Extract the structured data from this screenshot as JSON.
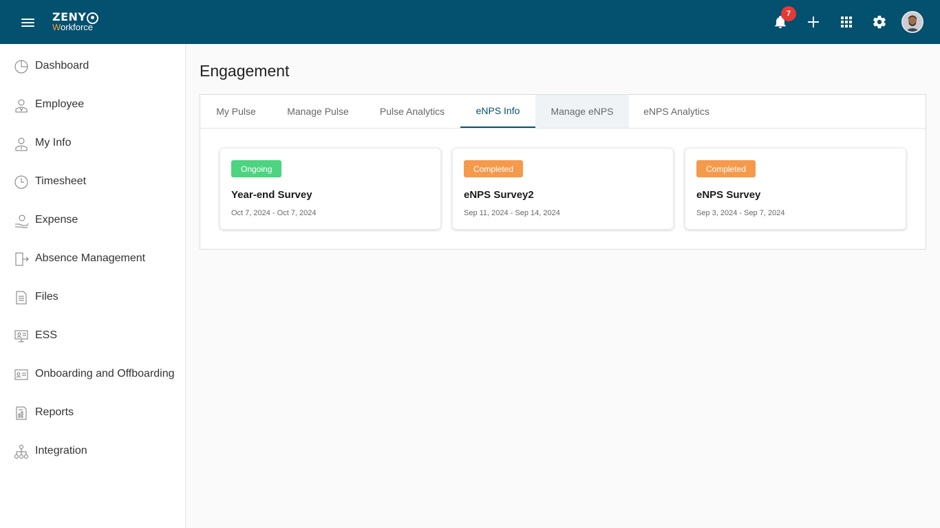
{
  "app": {
    "logo_top": "ZENY",
    "logo_bottom_first": "W",
    "logo_bottom_rest": "orkforce",
    "notification_count": "7",
    "colors": {
      "header": "#03506f",
      "accent": "#f39c45",
      "ongoing": "#4cd480",
      "completed": "#f59a4b",
      "badge": "#e53935"
    }
  },
  "header": {
    "icons": [
      "menu-icon",
      "bell-icon",
      "plus-icon",
      "apps-grid-icon",
      "gear-icon",
      "user-avatar"
    ]
  },
  "sidebar": {
    "items": [
      {
        "label": "Dashboard",
        "icon": "pie-chart-icon"
      },
      {
        "label": "Employee",
        "icon": "employee-icon"
      },
      {
        "label": "My Info",
        "icon": "user-info-icon"
      },
      {
        "label": "Timesheet",
        "icon": "clock-icon"
      },
      {
        "label": "Expense",
        "icon": "money-hand-icon"
      },
      {
        "label": "Absence Management",
        "icon": "exit-door-icon"
      },
      {
        "label": "Files",
        "icon": "file-icon"
      },
      {
        "label": "ESS",
        "icon": "monitor-user-icon"
      },
      {
        "label": "Onboarding and Offboarding",
        "icon": "id-card-icon"
      },
      {
        "label": "Reports",
        "icon": "report-icon"
      },
      {
        "label": "Integration",
        "icon": "hierarchy-icon"
      }
    ]
  },
  "main": {
    "title": "Engagement",
    "tabs": [
      {
        "label": "My Pulse"
      },
      {
        "label": "Manage Pulse"
      },
      {
        "label": "Pulse Analytics"
      },
      {
        "label": "eNPS Info",
        "active": true
      },
      {
        "label": "Manage eNPS",
        "hover": true
      },
      {
        "label": "eNPS Analytics"
      }
    ],
    "surveys": [
      {
        "status": "Ongoing",
        "title": "Year-end Survey",
        "dates": "Oct 7, 2024 - Oct 7, 2024"
      },
      {
        "status": "Completed",
        "title": "eNPS Survey2",
        "dates": "Sep 11, 2024 - Sep 14, 2024"
      },
      {
        "status": "Completed",
        "title": "eNPS Survey",
        "dates": "Sep 3, 2024 - Sep 7, 2024"
      }
    ]
  }
}
